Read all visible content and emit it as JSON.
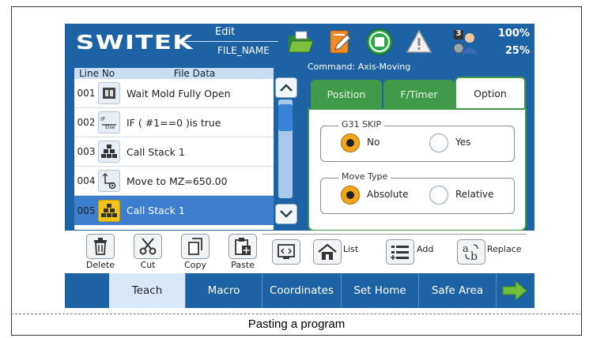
{
  "caption": "Pasting a program",
  "header": {
    "logo": "SWITEK",
    "mode": "Edit",
    "filename": "FILE_NAME",
    "speed_top": "100%",
    "speed_bottom": "25%",
    "badge": "3"
  },
  "table": {
    "col_line": "Line No",
    "col_data": "File Data",
    "rows": [
      {
        "line": "001",
        "icon": "mold-wait-icon",
        "text": "Wait Mold Fully Open"
      },
      {
        "line": "002",
        "icon": "if-else-icon",
        "text": "IF ( #1==0 )is true"
      },
      {
        "line": "003",
        "icon": "call-stack-icon",
        "text": "Call Stack 1"
      },
      {
        "line": "004",
        "icon": "move-axis-icon",
        "text": "Move to MZ=650.00"
      },
      {
        "line": "005",
        "icon": "call-stack-icon",
        "text": "Call Stack 1"
      }
    ],
    "selected_line": "005"
  },
  "command": {
    "label": "Command:",
    "value": "Axis-Moving"
  },
  "tabs": {
    "position": "Position",
    "ftimer": "F/Timer",
    "option": "Option"
  },
  "options": {
    "g31_label": "G31 SKIP",
    "g31_no": "No",
    "g31_yes": "Yes",
    "g31_selected": "No",
    "move_label": "Move Type",
    "move_absolute": "Absolute",
    "move_relative": "Relative",
    "move_selected": "Absolute"
  },
  "toolbar": {
    "delete": "Delete",
    "cut": "Cut",
    "copy": "Copy",
    "paste": "Paste",
    "list": "List",
    "add": "Add",
    "replace": "Replace"
  },
  "nav": {
    "teach": "Teach",
    "macro": "Macro",
    "coordinates": "Coordinates",
    "set_home": "Set Home",
    "safe_area": "Safe Area"
  },
  "colors": {
    "screen_bg": "#1e62a6",
    "tab_green": "#3f9b4a",
    "selected_row": "#3d7fce",
    "radio_on": "#f2a51a"
  }
}
